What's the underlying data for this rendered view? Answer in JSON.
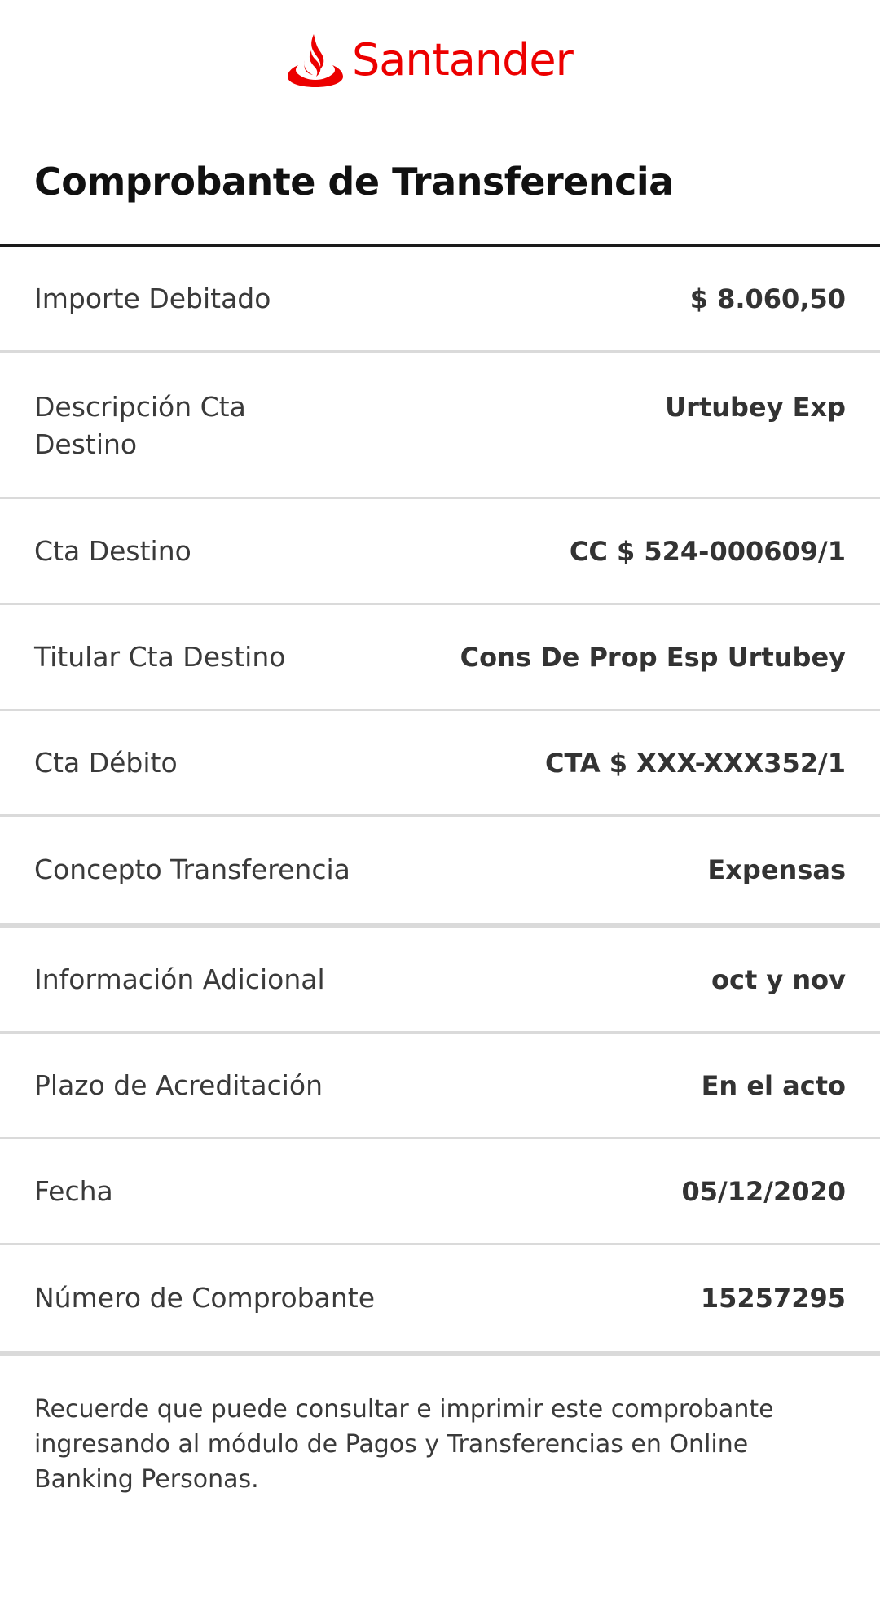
{
  "brand": {
    "name": "Santander",
    "color": "#ec0000",
    "logo_icon": "flame-icon"
  },
  "title": "Comprobante de Transferencia",
  "rows": [
    {
      "label": "Importe Debitado",
      "value": "$ 8.060,50"
    },
    {
      "label": "Descripción Cta Destino",
      "value": "Urtubey Exp"
    },
    {
      "label": "Cta Destino",
      "value": "CC $ 524-000609/1"
    },
    {
      "label": "Titular Cta Destino",
      "value": "Cons De Prop Esp Urtubey"
    },
    {
      "label": "Cta Débito",
      "value": "CTA $ XXX-XXX352/1"
    },
    {
      "label": "Concepto Transferencia",
      "value": "Expensas"
    },
    {
      "label": "Información Adicional",
      "value": "oct y nov"
    },
    {
      "label": "Plazo de Acreditación",
      "value": "En el acto"
    },
    {
      "label": "Fecha",
      "value": "05/12/2020"
    },
    {
      "label": "Número de Comprobante",
      "value": "15257295"
    }
  ],
  "footer_note": "Recuerde que puede consultar e imprimir este comprobante ingresando al módulo de Pagos y Transferencias en Online Banking Personas."
}
